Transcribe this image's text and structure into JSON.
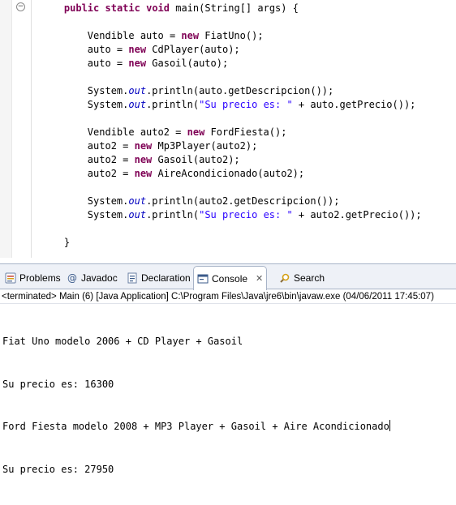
{
  "editor": {
    "fold_glyph": "−",
    "lines": [
      [
        [
          "t",
          "    "
        ],
        [
          "k",
          "public"
        ],
        [
          "t",
          " "
        ],
        [
          "k",
          "static"
        ],
        [
          "t",
          " "
        ],
        [
          "k",
          "void"
        ],
        [
          "t",
          " main(String[] args) {"
        ]
      ],
      [
        [
          "t",
          ""
        ]
      ],
      [
        [
          "t",
          "        Vendible auto = "
        ],
        [
          "k",
          "new"
        ],
        [
          "t",
          " FiatUno();"
        ]
      ],
      [
        [
          "t",
          "        auto = "
        ],
        [
          "k",
          "new"
        ],
        [
          "t",
          " CdPlayer(auto);"
        ]
      ],
      [
        [
          "t",
          "        auto = "
        ],
        [
          "k",
          "new"
        ],
        [
          "t",
          " Gasoil(auto);"
        ]
      ],
      [
        [
          "t",
          ""
        ]
      ],
      [
        [
          "t",
          "        System."
        ],
        [
          "f",
          "out"
        ],
        [
          "t",
          ".println(auto.getDescripcion());"
        ]
      ],
      [
        [
          "t",
          "        System."
        ],
        [
          "f",
          "out"
        ],
        [
          "t",
          ".println("
        ],
        [
          "s",
          "\"Su precio es: \""
        ],
        [
          "t",
          " + auto.getPrecio());"
        ]
      ],
      [
        [
          "t",
          ""
        ]
      ],
      [
        [
          "t",
          "        Vendible auto2 = "
        ],
        [
          "k",
          "new"
        ],
        [
          "t",
          " FordFiesta();"
        ]
      ],
      [
        [
          "t",
          "        auto2 = "
        ],
        [
          "k",
          "new"
        ],
        [
          "t",
          " Mp3Player(auto2);"
        ]
      ],
      [
        [
          "t",
          "        auto2 = "
        ],
        [
          "k",
          "new"
        ],
        [
          "t",
          " Gasoil(auto2);"
        ]
      ],
      [
        [
          "t",
          "        auto2 = "
        ],
        [
          "k",
          "new"
        ],
        [
          "t",
          " AireAcondicionado(auto2);"
        ]
      ],
      [
        [
          "t",
          ""
        ]
      ],
      [
        [
          "t",
          "        System."
        ],
        [
          "f",
          "out"
        ],
        [
          "t",
          ".println(auto2.getDescripcion());"
        ]
      ],
      [
        [
          "t",
          "        System."
        ],
        [
          "f",
          "out"
        ],
        [
          "t",
          ".println("
        ],
        [
          "s",
          "\"Su precio es: \""
        ],
        [
          "t",
          " + auto2.getPrecio());"
        ]
      ],
      [
        [
          "t",
          ""
        ]
      ],
      [
        [
          "t",
          "    }"
        ]
      ]
    ]
  },
  "tabs": [
    {
      "label": "Problems",
      "icon": "problems-icon"
    },
    {
      "label": "Javadoc",
      "icon": "javadoc-icon"
    },
    {
      "label": "Declaration",
      "icon": "declaration-icon"
    },
    {
      "label": "Console",
      "icon": "console-icon",
      "active": true,
      "close": "✕"
    },
    {
      "label": "Search",
      "icon": "search-icon"
    }
  ],
  "console": {
    "status": "<terminated> Main (6) [Java Application] C:\\Program Files\\Java\\jre6\\bin\\javaw.exe (04/06/2011 17:45:07)",
    "output": [
      "Fiat Uno modelo 2006 + CD Player + Gasoil",
      "Su precio es: 16300",
      "Ford Fiesta modelo 2008 + MP3 Player + Gasoil + Aire Acondicionado",
      "Su precio es: 27950"
    ]
  },
  "colors": {
    "keyword": "#7f0055",
    "field": "#0000c0",
    "string": "#2a00ff",
    "tab_border": "#a7b3c7"
  }
}
